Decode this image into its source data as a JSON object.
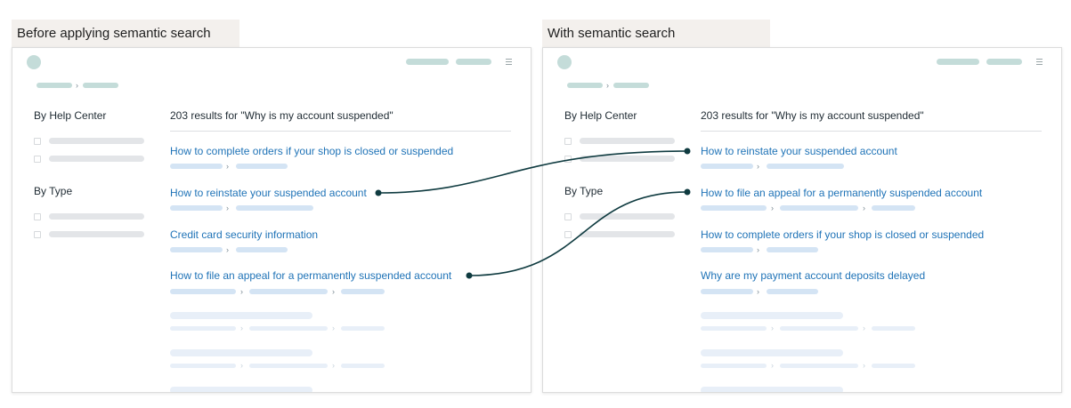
{
  "before": {
    "label": "Before applying semantic search",
    "sidebar": {
      "by_help_center": "By Help Center",
      "by_type": "By Type"
    },
    "results_heading": "203 results for \"Why is my account suspended\"",
    "results": [
      "How to complete orders if your shop is closed or suspended",
      "How to reinstate your suspended account",
      "Credit card security information",
      "How to file an appeal for a permanently suspended account"
    ]
  },
  "after": {
    "label": "With semantic search",
    "sidebar": {
      "by_help_center": "By Help Center",
      "by_type": "By Type"
    },
    "results_heading": "203 results for \"Why is my account suspended\"",
    "results": [
      "How to reinstate your suspended account",
      "How to file an appeal for a permanently suspended account",
      "How to complete orders if your shop is closed or suspended",
      "Why are my payment account deposits delayed"
    ]
  },
  "colors": {
    "link": "#1f73b7",
    "connector": "#0f3b40",
    "label_bg": "#f3f0ed"
  }
}
